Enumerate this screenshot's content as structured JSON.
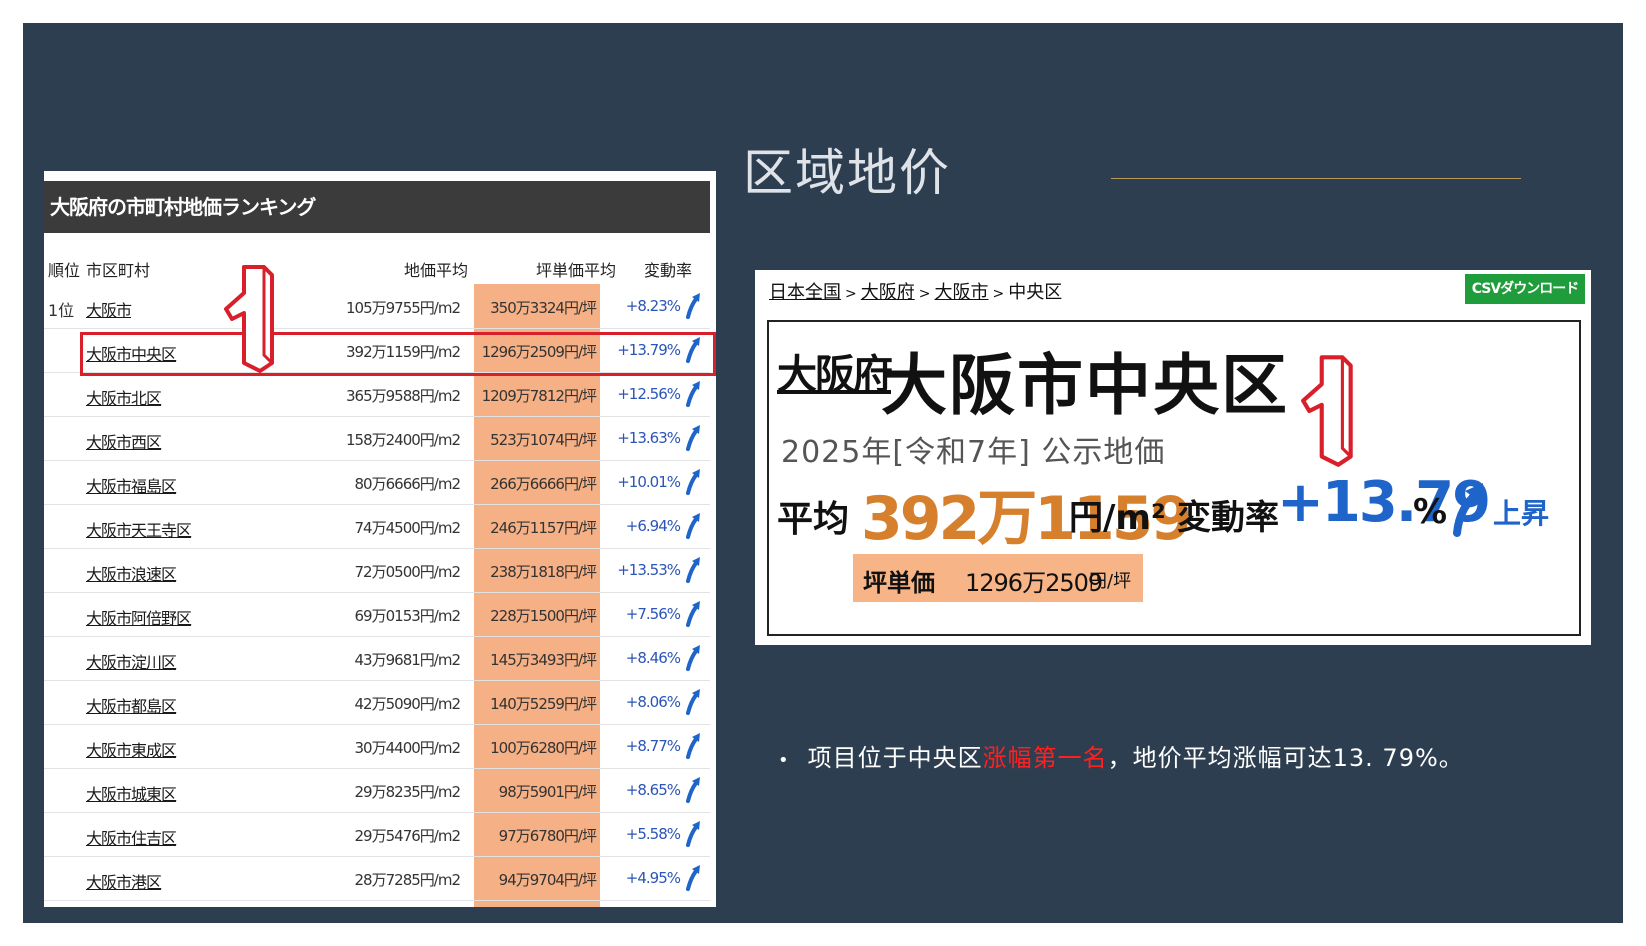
{
  "slide": {
    "title": "区域地价",
    "colors": {
      "background": "#2d3e50",
      "accent_line": "#b79a5c",
      "highlight_red": "#ff2020"
    }
  },
  "ranking": {
    "header": "大阪府の市町村地価ランキング",
    "columns": [
      "順位",
      "市区町村",
      "地価平均",
      "坪単価平均",
      "変動率"
    ],
    "rows": [
      {
        "rank": "1位",
        "name": "大阪市",
        "avg": "105万9755円/m2",
        "tsubo": "350万3324円/坪",
        "change": "+8.23%"
      },
      {
        "rank": "",
        "name": "大阪市中央区",
        "avg": "392万1159円/m2",
        "tsubo": "1296万2509円/坪",
        "change": "+13.79%"
      },
      {
        "rank": "",
        "name": "大阪市北区",
        "avg": "365万9588円/m2",
        "tsubo": "1209万7812円/坪",
        "change": "+12.56%"
      },
      {
        "rank": "",
        "name": "大阪市西区",
        "avg": "158万2400円/m2",
        "tsubo": "523万1074円/坪",
        "change": "+13.63%"
      },
      {
        "rank": "",
        "name": "大阪市福島区",
        "avg": "80万6666円/m2",
        "tsubo": "266万6666円/坪",
        "change": "+10.01%"
      },
      {
        "rank": "",
        "name": "大阪市天王寺区",
        "avg": "74万4500円/m2",
        "tsubo": "246万1157円/坪",
        "change": "+6.94%"
      },
      {
        "rank": "",
        "name": "大阪市浪速区",
        "avg": "72万0500円/m2",
        "tsubo": "238万1818円/坪",
        "change": "+13.53%"
      },
      {
        "rank": "",
        "name": "大阪市阿倍野区",
        "avg": "69万0153円/m2",
        "tsubo": "228万1500円/坪",
        "change": "+7.56%"
      },
      {
        "rank": "",
        "name": "大阪市淀川区",
        "avg": "43万9681円/m2",
        "tsubo": "145万3493円/坪",
        "change": "+8.46%"
      },
      {
        "rank": "",
        "name": "大阪市都島区",
        "avg": "42万5090円/m2",
        "tsubo": "140万5259円/坪",
        "change": "+8.06%"
      },
      {
        "rank": "",
        "name": "大阪市東成区",
        "avg": "30万4400円/m2",
        "tsubo": "100万6280円/坪",
        "change": "+8.77%"
      },
      {
        "rank": "",
        "name": "大阪市城東区",
        "avg": "29万8235円/m2",
        "tsubo": "98万5901円/坪",
        "change": "+8.65%"
      },
      {
        "rank": "",
        "name": "大阪市住吉区",
        "avg": "29万5476円/m2",
        "tsubo": "97万6780円/坪",
        "change": "+5.58%"
      },
      {
        "rank": "",
        "name": "大阪市港区",
        "avg": "28万7285円/m2",
        "tsubo": "94万9704円/坪",
        "change": "+4.95%"
      }
    ],
    "highlighted_row": 1,
    "annotation_icon": "big-number-one-icon"
  },
  "detail": {
    "breadcrumb": [
      "日本全国",
      "大阪府",
      "大阪市",
      "中央区"
    ],
    "csv_button": "CSVダウンロード",
    "prefecture": "大阪府",
    "ward": "大阪市中央区",
    "year_line": "2025年[令和7年] 公示地価",
    "avg_label": "平均",
    "avg_value": "392万1159",
    "avg_unit": "円/m²",
    "change_label": "変動率",
    "change_value": "+13.79",
    "change_pct": "%",
    "rise_label": "上昇",
    "tsubo_label": "坪単価",
    "tsubo_value": "1296万2509",
    "tsubo_unit": "円/坪"
  },
  "bullet": {
    "prefix": "项目位于中央区",
    "emphasis": "涨幅第一名",
    "suffix": "，地价平均涨幅可达13. 79%。"
  }
}
